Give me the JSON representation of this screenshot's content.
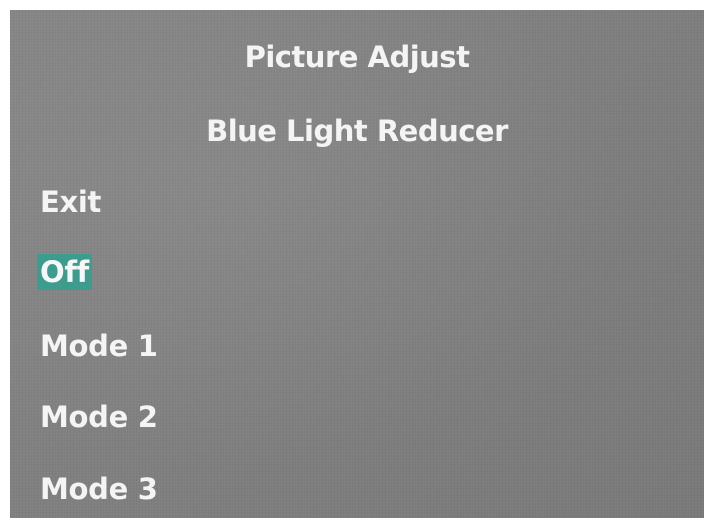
{
  "osd": {
    "title": "Picture Adjust",
    "subtitle": "Blue Light Reducer",
    "selected_index": 1,
    "highlight_color": "#3c9d8e",
    "background_color": "#808080",
    "items": [
      {
        "label": "Exit"
      },
      {
        "label": "Off"
      },
      {
        "label": "Mode 1"
      },
      {
        "label": "Mode 2"
      },
      {
        "label": "Mode 3"
      }
    ]
  }
}
